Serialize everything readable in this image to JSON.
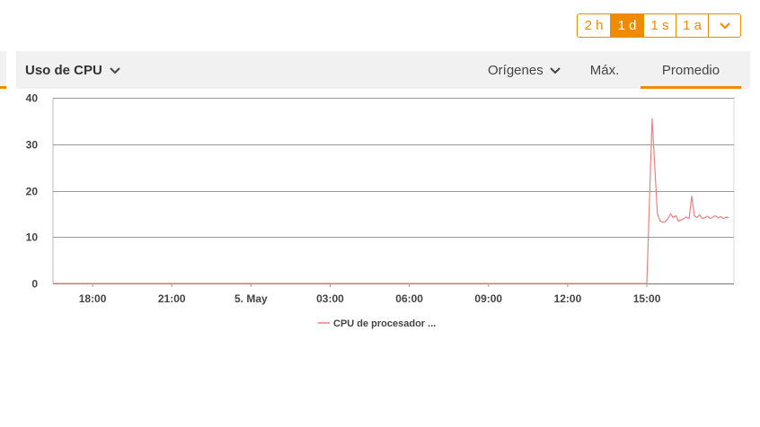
{
  "range_selector": {
    "options": [
      "2 h",
      "1 d",
      "1 s",
      "1 a"
    ],
    "selected": "1 d",
    "more_icon": "chevron-down-icon"
  },
  "header": {
    "title": "Uso de CPU",
    "title_icon": "chevron-down-icon",
    "origins_label": "Orígenes",
    "origins_icon": "chevron-down-icon",
    "tabs": [
      {
        "label": "Máx.",
        "active": false
      },
      {
        "label": "Promedio",
        "active": true
      }
    ]
  },
  "colors": {
    "accent": "#f08a00",
    "series": "#f08080",
    "grid": "#999999"
  },
  "chart_data": {
    "type": "line",
    "title": "",
    "xlabel": "",
    "ylabel": "",
    "ylim": [
      0,
      40
    ],
    "yticks": [
      0,
      10,
      20,
      30,
      40
    ],
    "xticks": [
      "18:00",
      "21:00",
      "5. May",
      "03:00",
      "06:00",
      "09:00",
      "12:00",
      "15:00"
    ],
    "xlim_hours": [
      -1.5,
      24.3
    ],
    "legend_position": "bottom-center",
    "series": [
      {
        "name": "CPU de procesador ...",
        "x_hours": [
          -1.5,
          21.0,
          21.2,
          21.4,
          21.5,
          21.6,
          21.7,
          21.8,
          21.9,
          22.0,
          22.1,
          22.2,
          22.3,
          22.4,
          22.5,
          22.6,
          22.7,
          22.8,
          22.9,
          23.0,
          23.1,
          23.2,
          23.3,
          23.4,
          23.5,
          23.6,
          23.7,
          23.8,
          23.9,
          24.0,
          24.1
        ],
        "values": [
          0,
          0,
          35.5,
          15,
          13.5,
          13.2,
          13.3,
          14,
          15,
          14.2,
          14.6,
          13.4,
          13.7,
          14,
          14.3,
          14,
          18.8,
          14.6,
          14.2,
          14.8,
          14.0,
          14.2,
          14.5,
          14.0,
          14.3,
          14.6,
          14.1,
          14.4,
          14.0,
          14.3,
          14.2
        ]
      }
    ]
  }
}
